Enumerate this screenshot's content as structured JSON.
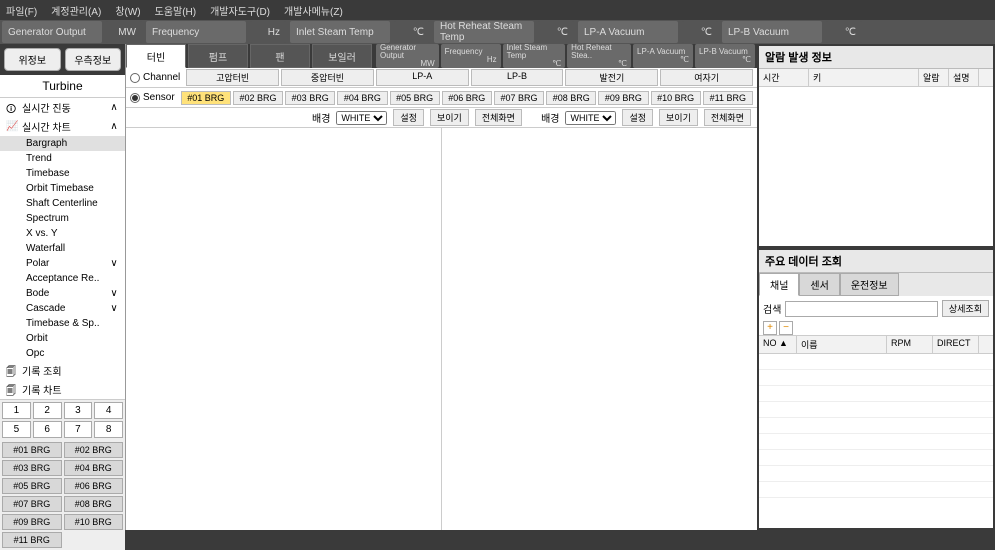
{
  "menu": {
    "file": "파일(F)",
    "account": "계정관리(A)",
    "window": "창(W)",
    "help": "도움말(H)",
    "dev": "개발자도구(D)",
    "devmenu": "개발사메뉴(Z)"
  },
  "status": {
    "items": [
      {
        "label": "Generator Output",
        "unit": "MW"
      },
      {
        "label": "Frequency",
        "unit": "Hz"
      },
      {
        "label": "Inlet Steam Temp",
        "unit": "℃"
      },
      {
        "label": "Hot Reheat Steam Temp",
        "unit": "℃"
      },
      {
        "label": "LP-A Vacuum",
        "unit": "℃"
      },
      {
        "label": "LP-B Vacuum",
        "unit": "℃"
      }
    ]
  },
  "left": {
    "loc": "위정보",
    "dock": "우측정보",
    "title": "Turbine",
    "groups": [
      {
        "label": "실시간 진동",
        "expand": "∧"
      },
      {
        "label": "실시간 차트",
        "expand": "∧"
      }
    ],
    "charts": [
      "Bargraph",
      "Trend",
      "Timebase",
      "Orbit Timebase",
      "Shaft Centerline",
      "Spectrum",
      "X vs. Y",
      "Waterfall",
      "Polar",
      "Acceptance Re..",
      "Bode",
      "Cascade",
      "Timebase & Sp..",
      "Orbit",
      "Opc"
    ],
    "history": "기록 조회",
    "histchart": "기록 차트",
    "nums": [
      "1",
      "2",
      "3",
      "4",
      "5",
      "6",
      "7",
      "8"
    ],
    "brgs": [
      "#01 BRG",
      "#02 BRG",
      "#03 BRG",
      "#04 BRG",
      "#05 BRG",
      "#06 BRG",
      "#07 BRG",
      "#08 BRG",
      "#09 BRG",
      "#10 BRG",
      "#11 BRG"
    ]
  },
  "center": {
    "tabs": [
      "터빈",
      "펌프",
      "팬",
      "보일러"
    ],
    "mini": [
      {
        "t": "Generator Output",
        "u": "MW"
      },
      {
        "t": "Frequency",
        "u": "Hz"
      },
      {
        "t": "Inlet Steam Temp",
        "u": "℃"
      },
      {
        "t": "Hot Reheat Stea..",
        "u": "℃"
      },
      {
        "t": "LP-A Vacuum",
        "u": "℃"
      },
      {
        "t": "LP-B Vacuum",
        "u": "℃"
      }
    ],
    "channel": "Channel",
    "sensor": "Sensor",
    "groups": [
      "고압터빈",
      "중압터빈",
      "LP-A",
      "LP-B",
      "발전기",
      "여자기"
    ],
    "sensors": [
      "#01 BRG",
      "#02 BRG",
      "#03 BRG",
      "#04 BRG",
      "#05 BRG",
      "#06 BRG",
      "#07 BRG",
      "#08 BRG",
      "#09 BRG",
      "#10 BRG",
      "#11 BRG"
    ],
    "bg": "배경",
    "white": "WHITE",
    "set": "설정",
    "show": "보이기",
    "full": "전체화면"
  },
  "right": {
    "alarm": {
      "title": "알람 발생 정보",
      "cols": [
        "시간",
        "키",
        "알람",
        "설명"
      ]
    },
    "data": {
      "title": "주요 데이터 조회",
      "tabs": [
        "채널",
        "센서",
        "운전정보"
      ],
      "search": "검색",
      "detail": "상세조회",
      "cols": [
        "NO ▲",
        "이름",
        "RPM",
        "DIRECT"
      ]
    }
  }
}
